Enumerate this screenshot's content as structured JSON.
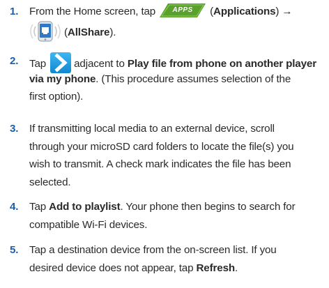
{
  "steps": [
    {
      "number": "1.",
      "t_from": "From the Home screen, tap",
      "apps_icon_text": "APPS",
      "t_apps_open": "(",
      "t_apps_label": "Applications",
      "t_apps_close": ") →",
      "t_allshare_open": "(",
      "t_allshare_label": "AllShare",
      "t_allshare_close": ")."
    },
    {
      "number": "2.",
      "t_tap": "Tap",
      "t_adjacent": "adjacent to",
      "t_bold_a": "Play file from phone on another player",
      "t_bold_b": "via my phone",
      "t_rest_a": ". (This procedure assumes selection of the",
      "t_rest_b": "first option)."
    },
    {
      "number": "3.",
      "lines": [
        "If transmitting local media to an external device, scroll",
        "through your microSD card folders to locate the file(s) you",
        "wish to transmit. A check mark indicates the file has been",
        "selected."
      ]
    },
    {
      "number": "4.",
      "t_tap": "Tap",
      "t_bold": "Add to playlist",
      "t_rest_a": ". Your phone then begins to search for",
      "t_rest_b": "compatible Wi-Fi devices."
    },
    {
      "number": "5.",
      "t_line1": "Tap a destination device from the on-screen list. If you",
      "t_line2_a": "desired device does not appear, tap",
      "t_bold": "Refresh",
      "t_line2_end": "."
    }
  ],
  "icons": {
    "apps": "apps-icon",
    "allshare": "allshare-icon",
    "chevron": "chevron-right-icon"
  },
  "colors": {
    "step_number": "#1c5fa8",
    "apps_badge": "#5aa02c",
    "chevron_button": "#1b9be0"
  }
}
